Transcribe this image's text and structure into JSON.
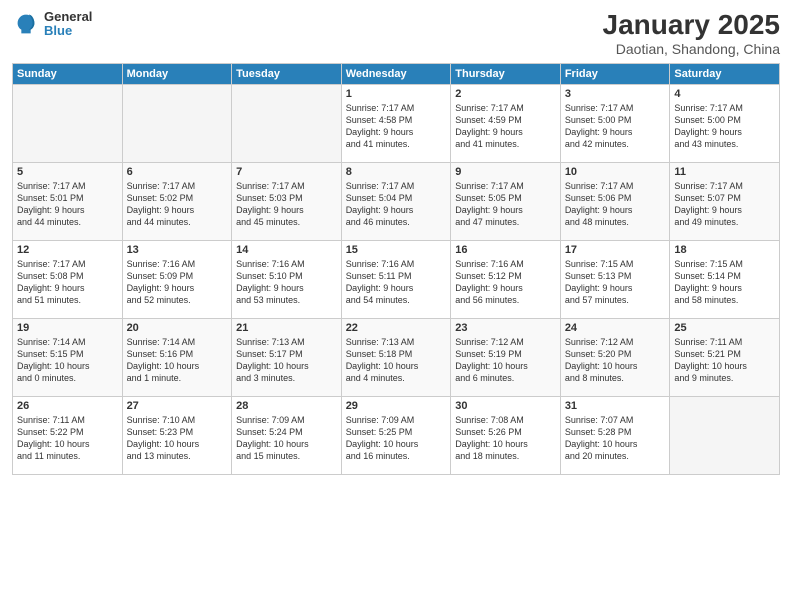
{
  "logo": {
    "general": "General",
    "blue": "Blue"
  },
  "title": "January 2025",
  "subtitle": "Daotian, Shandong, China",
  "days_of_week": [
    "Sunday",
    "Monday",
    "Tuesday",
    "Wednesday",
    "Thursday",
    "Friday",
    "Saturday"
  ],
  "weeks": [
    [
      {
        "day": "",
        "info": ""
      },
      {
        "day": "",
        "info": ""
      },
      {
        "day": "",
        "info": ""
      },
      {
        "day": "1",
        "info": "Sunrise: 7:17 AM\nSunset: 4:58 PM\nDaylight: 9 hours\nand 41 minutes."
      },
      {
        "day": "2",
        "info": "Sunrise: 7:17 AM\nSunset: 4:59 PM\nDaylight: 9 hours\nand 41 minutes."
      },
      {
        "day": "3",
        "info": "Sunrise: 7:17 AM\nSunset: 5:00 PM\nDaylight: 9 hours\nand 42 minutes."
      },
      {
        "day": "4",
        "info": "Sunrise: 7:17 AM\nSunset: 5:00 PM\nDaylight: 9 hours\nand 43 minutes."
      }
    ],
    [
      {
        "day": "5",
        "info": "Sunrise: 7:17 AM\nSunset: 5:01 PM\nDaylight: 9 hours\nand 44 minutes."
      },
      {
        "day": "6",
        "info": "Sunrise: 7:17 AM\nSunset: 5:02 PM\nDaylight: 9 hours\nand 44 minutes."
      },
      {
        "day": "7",
        "info": "Sunrise: 7:17 AM\nSunset: 5:03 PM\nDaylight: 9 hours\nand 45 minutes."
      },
      {
        "day": "8",
        "info": "Sunrise: 7:17 AM\nSunset: 5:04 PM\nDaylight: 9 hours\nand 46 minutes."
      },
      {
        "day": "9",
        "info": "Sunrise: 7:17 AM\nSunset: 5:05 PM\nDaylight: 9 hours\nand 47 minutes."
      },
      {
        "day": "10",
        "info": "Sunrise: 7:17 AM\nSunset: 5:06 PM\nDaylight: 9 hours\nand 48 minutes."
      },
      {
        "day": "11",
        "info": "Sunrise: 7:17 AM\nSunset: 5:07 PM\nDaylight: 9 hours\nand 49 minutes."
      }
    ],
    [
      {
        "day": "12",
        "info": "Sunrise: 7:17 AM\nSunset: 5:08 PM\nDaylight: 9 hours\nand 51 minutes."
      },
      {
        "day": "13",
        "info": "Sunrise: 7:16 AM\nSunset: 5:09 PM\nDaylight: 9 hours\nand 52 minutes."
      },
      {
        "day": "14",
        "info": "Sunrise: 7:16 AM\nSunset: 5:10 PM\nDaylight: 9 hours\nand 53 minutes."
      },
      {
        "day": "15",
        "info": "Sunrise: 7:16 AM\nSunset: 5:11 PM\nDaylight: 9 hours\nand 54 minutes."
      },
      {
        "day": "16",
        "info": "Sunrise: 7:16 AM\nSunset: 5:12 PM\nDaylight: 9 hours\nand 56 minutes."
      },
      {
        "day": "17",
        "info": "Sunrise: 7:15 AM\nSunset: 5:13 PM\nDaylight: 9 hours\nand 57 minutes."
      },
      {
        "day": "18",
        "info": "Sunrise: 7:15 AM\nSunset: 5:14 PM\nDaylight: 9 hours\nand 58 minutes."
      }
    ],
    [
      {
        "day": "19",
        "info": "Sunrise: 7:14 AM\nSunset: 5:15 PM\nDaylight: 10 hours\nand 0 minutes."
      },
      {
        "day": "20",
        "info": "Sunrise: 7:14 AM\nSunset: 5:16 PM\nDaylight: 10 hours\nand 1 minute."
      },
      {
        "day": "21",
        "info": "Sunrise: 7:13 AM\nSunset: 5:17 PM\nDaylight: 10 hours\nand 3 minutes."
      },
      {
        "day": "22",
        "info": "Sunrise: 7:13 AM\nSunset: 5:18 PM\nDaylight: 10 hours\nand 4 minutes."
      },
      {
        "day": "23",
        "info": "Sunrise: 7:12 AM\nSunset: 5:19 PM\nDaylight: 10 hours\nand 6 minutes."
      },
      {
        "day": "24",
        "info": "Sunrise: 7:12 AM\nSunset: 5:20 PM\nDaylight: 10 hours\nand 8 minutes."
      },
      {
        "day": "25",
        "info": "Sunrise: 7:11 AM\nSunset: 5:21 PM\nDaylight: 10 hours\nand 9 minutes."
      }
    ],
    [
      {
        "day": "26",
        "info": "Sunrise: 7:11 AM\nSunset: 5:22 PM\nDaylight: 10 hours\nand 11 minutes."
      },
      {
        "day": "27",
        "info": "Sunrise: 7:10 AM\nSunset: 5:23 PM\nDaylight: 10 hours\nand 13 minutes."
      },
      {
        "day": "28",
        "info": "Sunrise: 7:09 AM\nSunset: 5:24 PM\nDaylight: 10 hours\nand 15 minutes."
      },
      {
        "day": "29",
        "info": "Sunrise: 7:09 AM\nSunset: 5:25 PM\nDaylight: 10 hours\nand 16 minutes."
      },
      {
        "day": "30",
        "info": "Sunrise: 7:08 AM\nSunset: 5:26 PM\nDaylight: 10 hours\nand 18 minutes."
      },
      {
        "day": "31",
        "info": "Sunrise: 7:07 AM\nSunset: 5:28 PM\nDaylight: 10 hours\nand 20 minutes."
      },
      {
        "day": "",
        "info": ""
      }
    ]
  ]
}
